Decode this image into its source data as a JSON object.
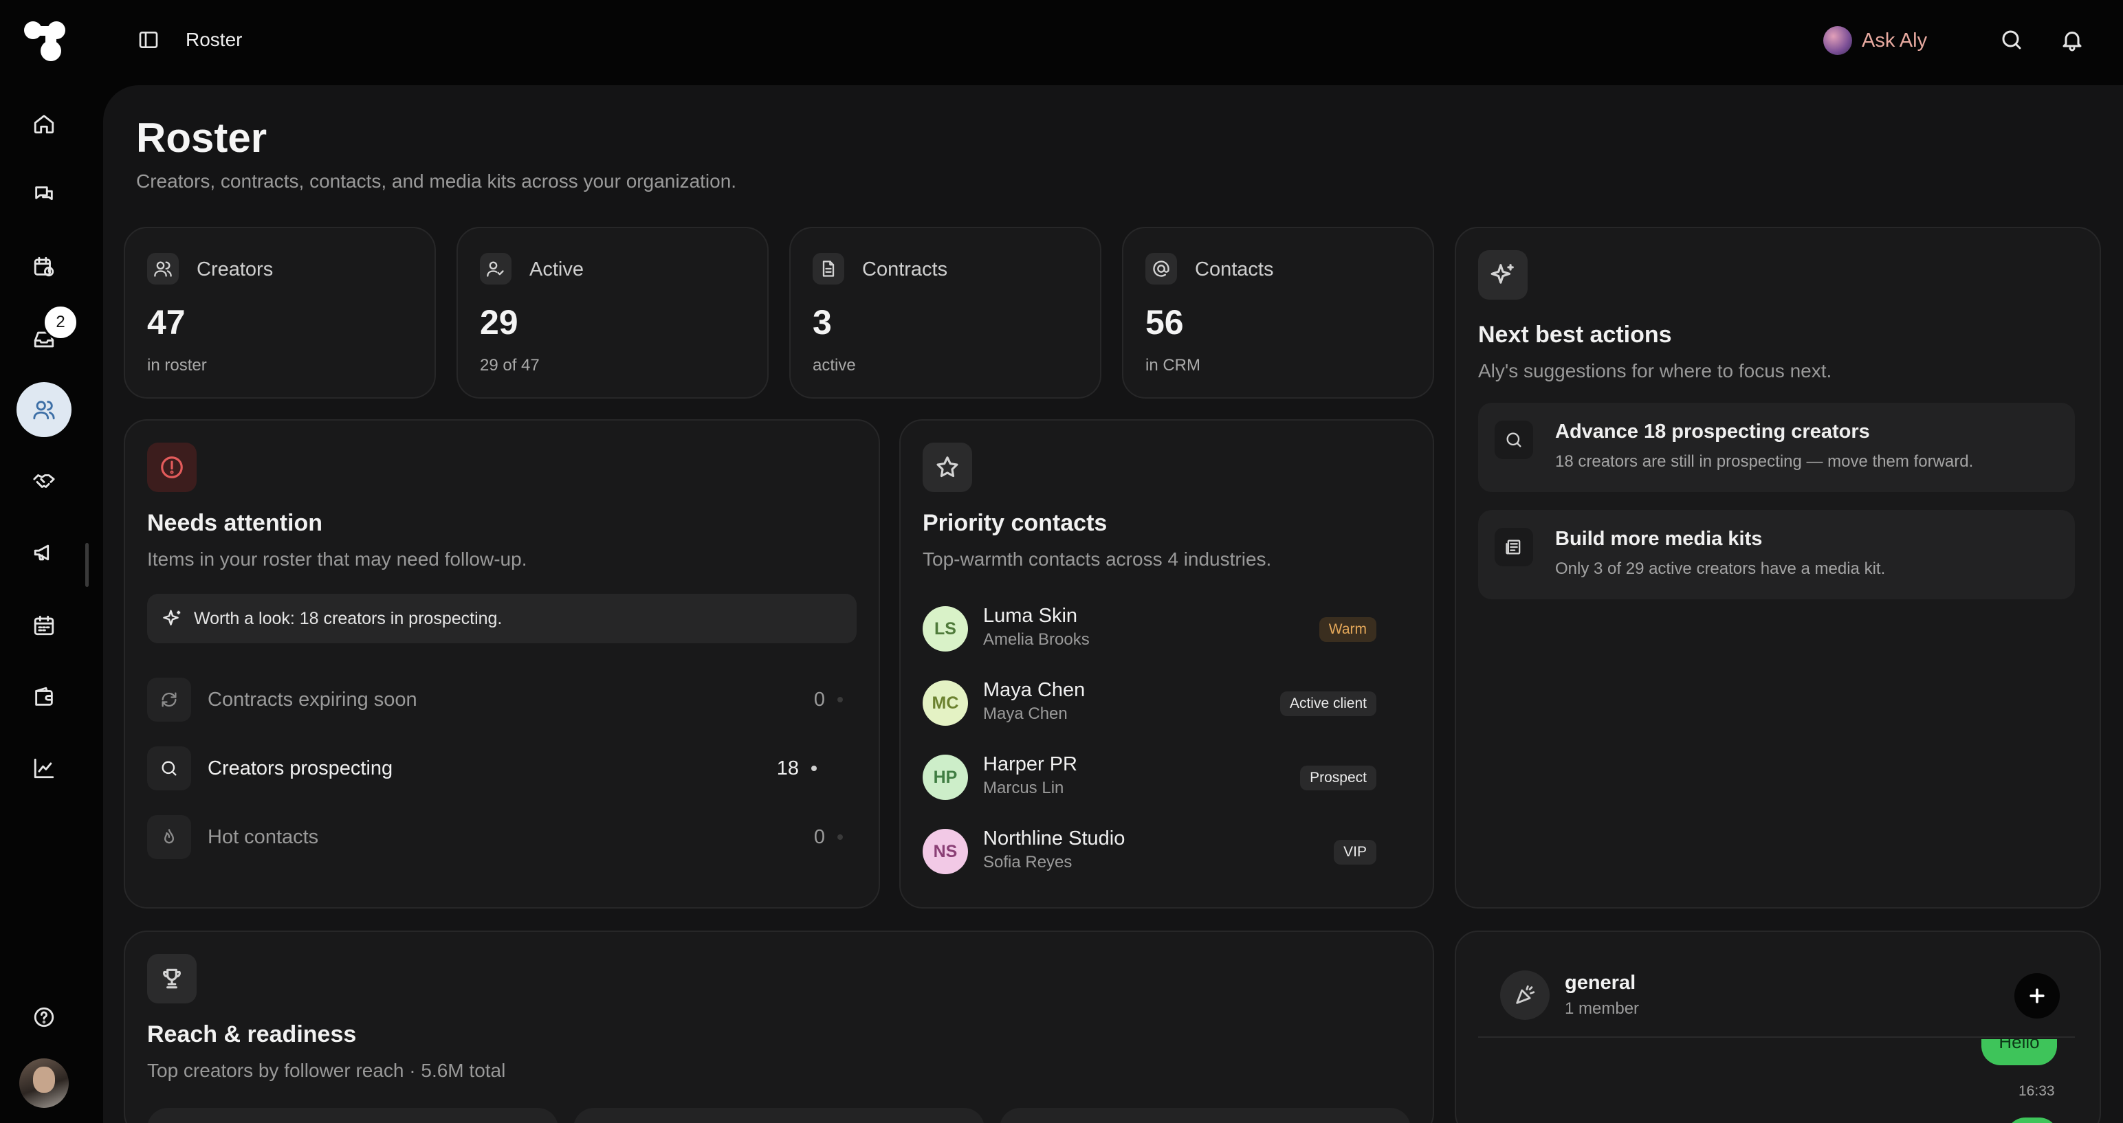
{
  "header": {
    "breadcrumb": "Roster",
    "ask_label": "Ask Aly"
  },
  "sidebar": {
    "items": [
      {
        "name": "home",
        "icon": "home-icon"
      },
      {
        "name": "messages",
        "icon": "chat-bubbles-icon"
      },
      {
        "name": "schedule",
        "icon": "calendar-clock-icon"
      },
      {
        "name": "inbox",
        "icon": "inbox-icon",
        "badge": "2"
      },
      {
        "name": "roster",
        "icon": "users-icon",
        "active": true
      },
      {
        "name": "deals",
        "icon": "handshake-icon"
      },
      {
        "name": "campaigns",
        "icon": "megaphone-icon"
      },
      {
        "name": "calendar",
        "icon": "calendar-icon"
      },
      {
        "name": "wallet",
        "icon": "wallet-icon"
      },
      {
        "name": "analytics",
        "icon": "line-chart-icon"
      }
    ],
    "help_icon": "help-circle-icon"
  },
  "page": {
    "title": "Roster",
    "subtitle": "Creators, contracts, contacts, and media kits across your organization."
  },
  "stats": [
    {
      "label": "Creators",
      "value": "47",
      "caption": "in roster",
      "icon": "users-icon"
    },
    {
      "label": "Active",
      "value": "29",
      "caption": "29 of 47",
      "icon": "user-check-icon"
    },
    {
      "label": "Contracts",
      "value": "3",
      "caption": "active",
      "icon": "file-icon"
    },
    {
      "label": "Contacts",
      "value": "56",
      "caption": "in CRM",
      "icon": "at-sign-icon"
    }
  ],
  "attention": {
    "title": "Needs attention",
    "subtitle": "Items in your roster that may need follow-up.",
    "hint": "Worth a look: 18 creators in prospecting.",
    "rows": [
      {
        "label": "Contracts expiring soon",
        "count": "0",
        "icon": "refresh-icon",
        "active": false
      },
      {
        "label": "Creators prospecting",
        "count": "18",
        "icon": "search-icon",
        "active": true
      },
      {
        "label": "Hot contacts",
        "count": "0",
        "icon": "flame-icon",
        "active": false
      }
    ]
  },
  "priority": {
    "title": "Priority contacts",
    "subtitle": "Top-warmth contacts across 4 industries.",
    "contacts": [
      {
        "initials": "LS",
        "name": "Luma Skin",
        "person": "Amelia Brooks",
        "tag": "Warm",
        "avatar_bg": "#d9f2c8",
        "avatar_fg": "#4f7a3a",
        "tag_color": "#e6a95a"
      },
      {
        "initials": "MC",
        "name": "Maya Chen",
        "person": "Maya Chen",
        "tag": "Active client",
        "avatar_bg": "#e4f2c4",
        "avatar_fg": "#6c8230",
        "tag_color": "#ececec"
      },
      {
        "initials": "HP",
        "name": "Harper PR",
        "person": "Marcus Lin",
        "tag": "Prospect",
        "avatar_bg": "#cdeec9",
        "avatar_fg": "#3f7d42",
        "tag_color": "#ececec"
      },
      {
        "initials": "NS",
        "name": "Northline Studio",
        "person": "Sofia Reyes",
        "tag": "VIP",
        "avatar_bg": "#f2c9e6",
        "avatar_fg": "#8a3f75",
        "tag_color": "#ececec"
      }
    ]
  },
  "actions": {
    "title": "Next best actions",
    "subtitle": "Aly's suggestions for where to focus next.",
    "items": [
      {
        "title": "Advance 18 prospecting creators",
        "desc": "18 creators are still in prospecting — move them forward.",
        "icon": "search-icon"
      },
      {
        "title": "Build more media kits",
        "desc": "Only 3 of 29 active creators have a media kit.",
        "icon": "newspaper-icon"
      }
    ]
  },
  "reach": {
    "title": "Reach & readiness",
    "subtitle": "Top creators by follower reach · 5.6M total"
  },
  "chat": {
    "channel": "general",
    "members": "1 member",
    "bubble_text": "Hello",
    "time": "16:33"
  },
  "colors": {
    "accent_green": "#3ec45a",
    "ask_text": "#e8aaa0",
    "alert_red": "#e35b5b"
  }
}
